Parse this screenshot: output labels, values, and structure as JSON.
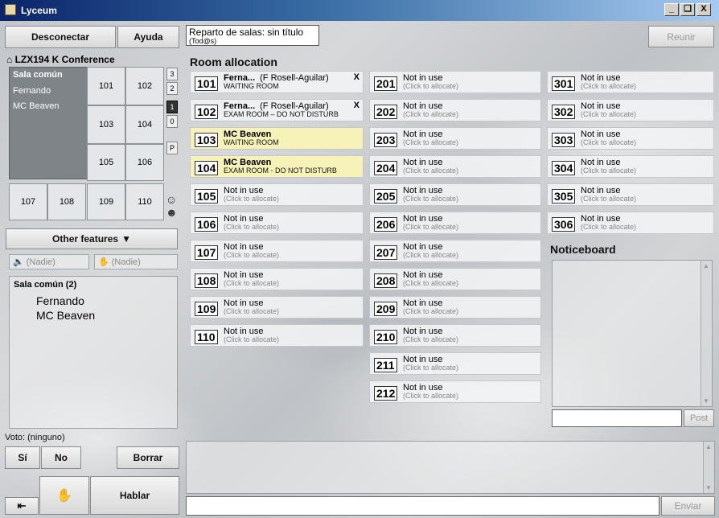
{
  "window": {
    "title": "Lyceum",
    "controls": [
      "_",
      "ř",
      "X"
    ]
  },
  "toolbar": {
    "disconnect": "Desconectar",
    "help": "Ayuda",
    "session_title": "Reparto de salas: sin título",
    "session_sub": "(Tod@s)",
    "reunir": "Reunir"
  },
  "conference": {
    "name": "LZX194 K Conference",
    "sala_comun": {
      "title": "Sala común",
      "members": [
        "Fernando",
        "MC Beaven"
      ]
    },
    "cells": [
      "101",
      "102",
      "103",
      "104",
      "105",
      "106",
      "107",
      "108",
      "109",
      "110"
    ],
    "side_buttons": [
      "3",
      "2",
      "1",
      "0",
      "P"
    ]
  },
  "other_features": "Other features",
  "speaker_none": "(Nadie)",
  "hand_none": "(Nadie)",
  "participants": {
    "heading": "Sala común  (2)",
    "names": [
      "Fernando",
      "MC Beaven"
    ]
  },
  "vote": {
    "label": "Voto: (ninguno)",
    "yes": "Sí",
    "no": "No",
    "clear": "Borrar"
  },
  "speak": "Hablar",
  "room_allocation": {
    "title": "Room allocation",
    "col1": [
      {
        "num": "101",
        "name": "Ferna...",
        "extra": "(F Rosell-Aguilar)",
        "x": "X",
        "desc": "WAITING ROOM",
        "state": "occ2"
      },
      {
        "num": "102",
        "name": "Ferna...",
        "extra": "(F Rosell-Aguilar)",
        "x": "X",
        "desc": "EXAM ROOM – DO NOT DISTURB",
        "state": "occ2"
      },
      {
        "num": "103",
        "name": "MC Beaven",
        "extra": "",
        "x": "",
        "desc": "WAITING ROOM",
        "state": "occupied"
      },
      {
        "num": "104",
        "name": "MC Beaven",
        "extra": "",
        "x": "",
        "desc": "EXAM ROOM - DO NOT DISTURB",
        "state": "occupied"
      },
      {
        "num": "105",
        "name": "Not in use",
        "desc": "(Click to allocate)",
        "state": "free"
      },
      {
        "num": "106",
        "name": "Not in use",
        "desc": "(Click to allocate)",
        "state": "free"
      },
      {
        "num": "107",
        "name": "Not in use",
        "desc": "(Click to allocate)",
        "state": "free"
      },
      {
        "num": "108",
        "name": "Not in use",
        "desc": "(Click to allocate)",
        "state": "free"
      },
      {
        "num": "109",
        "name": "Not in use",
        "desc": "(Click to allocate)",
        "state": "free"
      },
      {
        "num": "110",
        "name": "Not in use",
        "desc": "(Click to allocate)",
        "state": "free"
      }
    ],
    "col2": [
      {
        "num": "201",
        "name": "Not in use",
        "desc": "(Click to allocate)"
      },
      {
        "num": "202",
        "name": "Not in use",
        "desc": "(Click to allocate)"
      },
      {
        "num": "203",
        "name": "Not in use",
        "desc": "(Click to allocate)"
      },
      {
        "num": "204",
        "name": "Not in use",
        "desc": "(Click to allocate)"
      },
      {
        "num": "205",
        "name": "Not in use",
        "desc": "(Click to allocate)"
      },
      {
        "num": "206",
        "name": "Not in use",
        "desc": "(Click to allocate)"
      },
      {
        "num": "207",
        "name": "Not in use",
        "desc": "(Click to allocate)"
      },
      {
        "num": "208",
        "name": "Not in use",
        "desc": "(Click to allocate)"
      },
      {
        "num": "209",
        "name": "Not in use",
        "desc": "(Click to allocate)"
      },
      {
        "num": "210",
        "name": "Not in use",
        "desc": "(Click to allocate)"
      },
      {
        "num": "211",
        "name": "Not in use",
        "desc": "(Click to allocate)"
      },
      {
        "num": "212",
        "name": "Not in use",
        "desc": "(Click to allocate)"
      }
    ],
    "col3": [
      {
        "num": "301",
        "name": "Not in use",
        "desc": "(Click to allocate)"
      },
      {
        "num": "302",
        "name": "Not in use",
        "desc": "(Click to allocate)"
      },
      {
        "num": "303",
        "name": "Not in use",
        "desc": "(Click to allocate)"
      },
      {
        "num": "304",
        "name": "Not in use",
        "desc": "(Click to allocate)"
      },
      {
        "num": "305",
        "name": "Not in use",
        "desc": "(Click to allocate)"
      },
      {
        "num": "306",
        "name": "Not in use",
        "desc": "(Click to allocate)"
      }
    ]
  },
  "noticeboard": {
    "title": "Noticeboard",
    "post": "Post"
  },
  "chat": {
    "send": "Enviar"
  }
}
